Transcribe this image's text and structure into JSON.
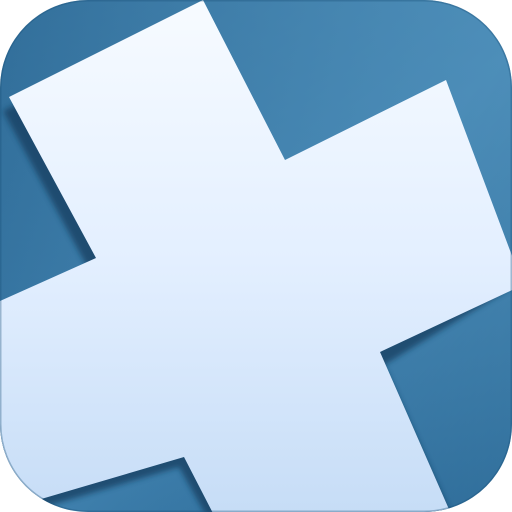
{
  "icon": {
    "name": "plus-cross-icon",
    "colors": {
      "tile_top": "#4a8db6",
      "tile_bottom": "#1f5e8c",
      "cross_top": "#f5faff",
      "cross_bottom": "#c9dff6",
      "shadow": "#133e5e"
    }
  }
}
